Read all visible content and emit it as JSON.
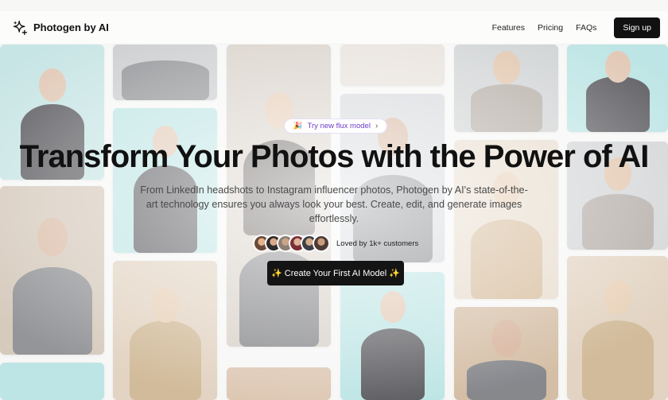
{
  "nav": {
    "brand_name": "Photogen by AI",
    "brand_icon": "sparkle-icon",
    "links": [
      "Features",
      "Pricing",
      "FAQs"
    ],
    "signup_label": "Sign up"
  },
  "hero": {
    "pill_emoji": "🎉",
    "pill_label": "Try new flux model",
    "pill_chevron": "›",
    "headline": "Transform Your Photos with the Power of AI",
    "subtitle": "From LinkedIn headshots to Instagram influencer photos, Photogen by AI's state-of-the-art technology ensures you always look your best. Create, edit, and generate images effortlessly.",
    "social_proof": "Loved by 1k+ customers",
    "cta_label": "✨ Create Your First AI Model ✨"
  },
  "colors": {
    "accent_purple": "#6f3cc9",
    "dark": "#111111",
    "tile_cyan": "#9fd3d6",
    "tile_warm": "#d9c6b2",
    "tile_gray": "#c9c7c3"
  }
}
